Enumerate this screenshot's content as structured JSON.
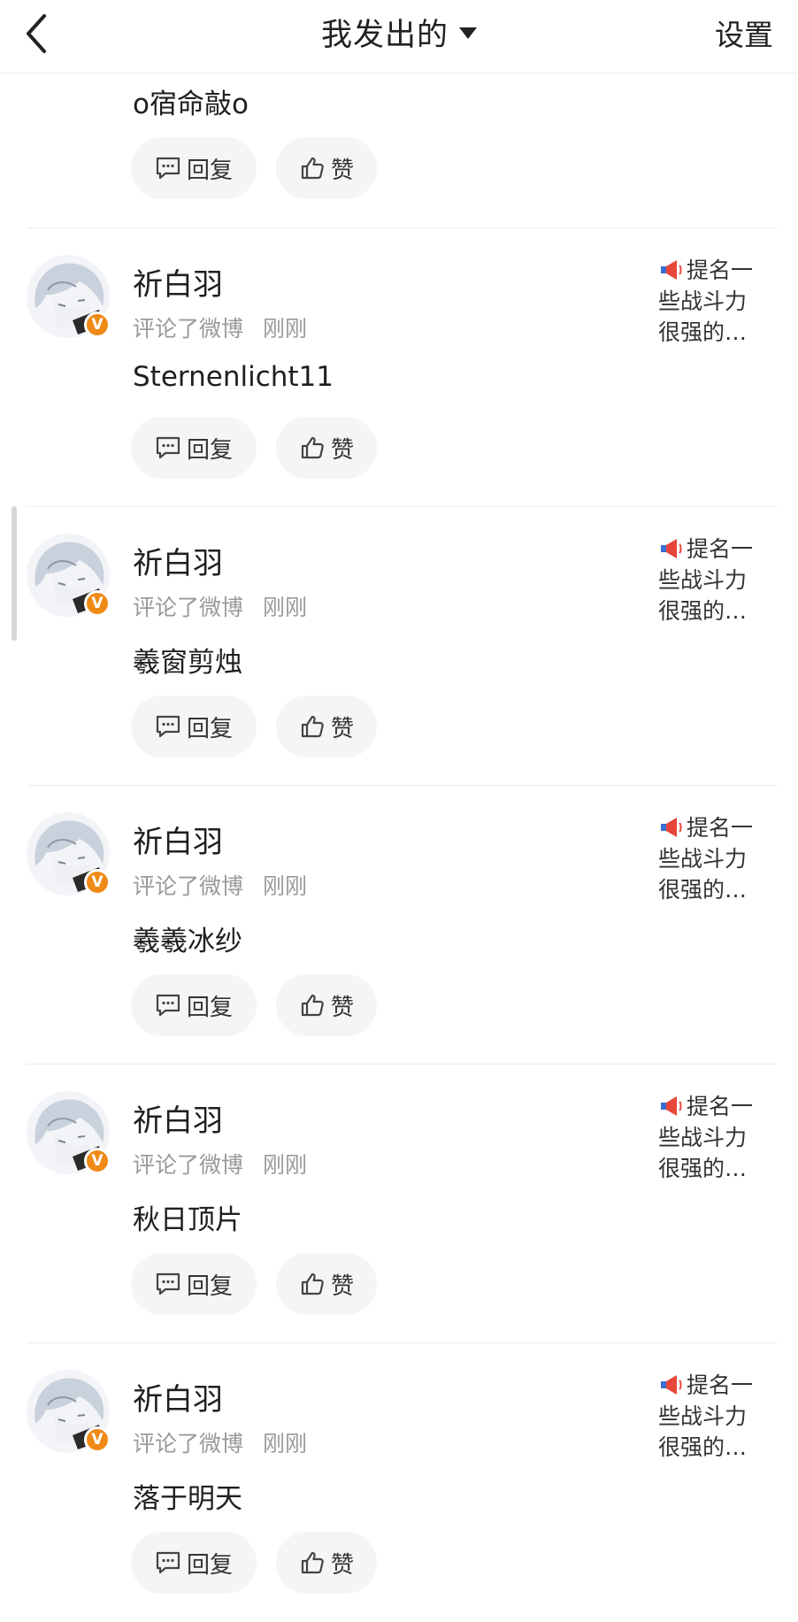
{
  "header": {
    "title": "我发出的",
    "settings_label": "设置"
  },
  "partial_item": {
    "comment": "o宿命敲o",
    "reply_label": "回复",
    "like_label": "赞"
  },
  "items": [
    {
      "username": "祈白羽",
      "action": "评论了微博",
      "time": "刚刚",
      "comment": "Sternenlicht11",
      "preview_lines": [
        "提名一",
        "些战斗力",
        "很强的…"
      ],
      "reply_label": "回复",
      "like_label": "赞"
    },
    {
      "username": "祈白羽",
      "action": "评论了微博",
      "time": "刚刚",
      "comment": "羲窗剪烛",
      "preview_lines": [
        "提名一",
        "些战斗力",
        "很强的…"
      ],
      "reply_label": "回复",
      "like_label": "赞"
    },
    {
      "username": "祈白羽",
      "action": "评论了微博",
      "time": "刚刚",
      "comment": "羲羲冰纱",
      "preview_lines": [
        "提名一",
        "些战斗力",
        "很强的…"
      ],
      "reply_label": "回复",
      "like_label": "赞"
    },
    {
      "username": "祈白羽",
      "action": "评论了微博",
      "time": "刚刚",
      "comment": "秋日顶片",
      "preview_lines": [
        "提名一",
        "些战斗力",
        "很强的…"
      ],
      "reply_label": "回复",
      "like_label": "赞"
    },
    {
      "username": "祈白羽",
      "action": "评论了微博",
      "time": "刚刚",
      "comment": "落于明天",
      "preview_lines": [
        "提名一",
        "些战斗力",
        "很强的…"
      ],
      "reply_label": "回复",
      "like_label": "赞"
    }
  ],
  "icons": {
    "back": "chevron-left-icon",
    "dropdown": "caret-down-icon",
    "reply": "comment-bubble-icon",
    "like": "thumbs-up-icon",
    "preview": "megaphone-icon",
    "verified": "verified-badge-icon"
  },
  "colors": {
    "verified_badge": "#f08a16",
    "pill_background": "#f5f5f5",
    "meta_text": "#9a9a9a"
  }
}
